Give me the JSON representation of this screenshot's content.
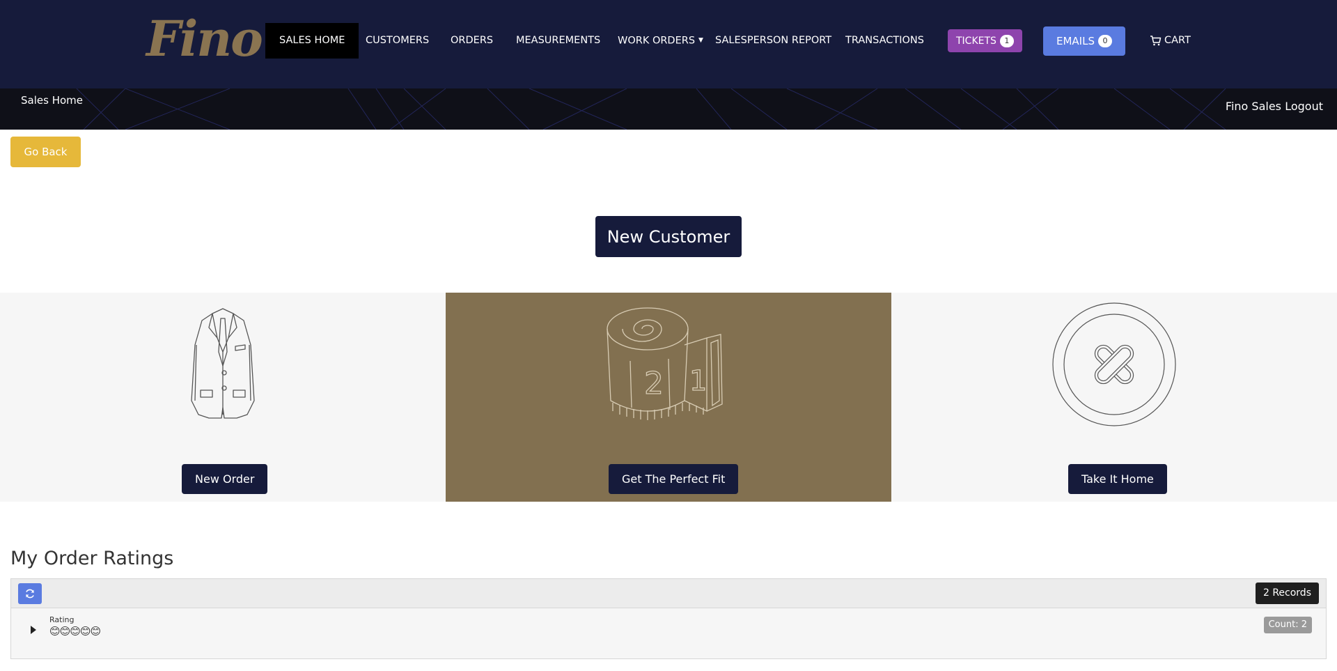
{
  "brand": {
    "logo_text": "Fino",
    "logo_color": "#8a7451"
  },
  "nav": {
    "items": [
      {
        "label": "SALES HOME",
        "active": true
      },
      {
        "label": "CUSTOMERS"
      },
      {
        "label": "ORDERS"
      },
      {
        "label": "MEASUREMENTS"
      },
      {
        "label": "WORK ORDERS",
        "dropdown": true
      },
      {
        "label": "SALESPERSON REPORT"
      },
      {
        "label": "TRANSACTIONS"
      }
    ],
    "tickets": {
      "label": "TICKETS",
      "count": "1",
      "color": "#8e44ad"
    },
    "emails": {
      "label": "EMAILS",
      "count": "0",
      "color": "#5a7be0"
    },
    "cart": {
      "label": "CART",
      "icon": "cart-icon"
    },
    "background": "#161b3b"
  },
  "subbar": {
    "breadcrumb": "Sales Home",
    "user_name": "Fino Sales",
    "logout_label": "Logout"
  },
  "actions": {
    "go_back_label": "Go Back",
    "go_back_color": "#e6b83a",
    "new_customer_label": "New Customer"
  },
  "tiles": [
    {
      "icon": "suit-jacket-icon",
      "button_label": "New Order"
    },
    {
      "icon": "measuring-tape-icon",
      "button_label": "Get The Perfect Fit",
      "background": "#827050"
    },
    {
      "icon": "button-icon",
      "button_label": "Take It Home"
    }
  ],
  "ratings": {
    "title": "My Order Ratings",
    "records_label": "2 Records",
    "refresh_icon": "refresh-icon",
    "group": {
      "field_label": "Rating",
      "value": "😊😊😊😊😊",
      "count_label": "Count: 2"
    }
  }
}
